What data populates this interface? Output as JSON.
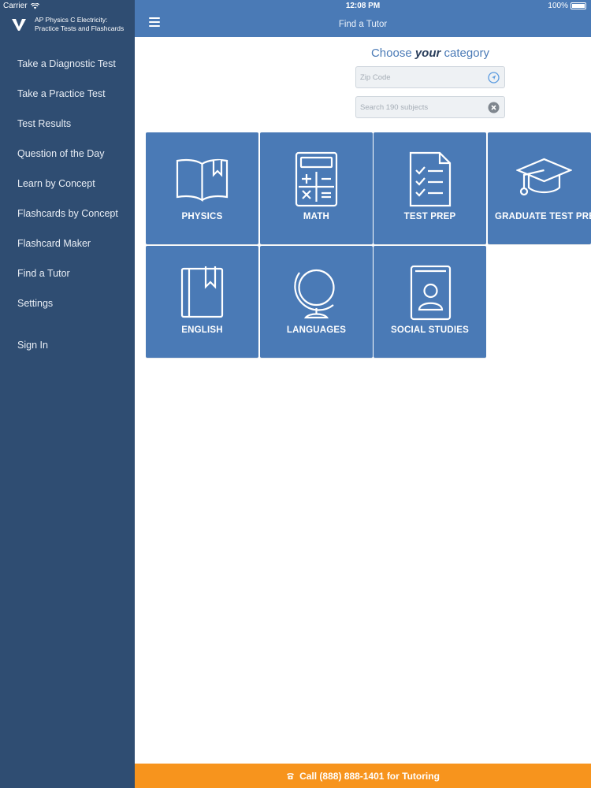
{
  "status": {
    "carrier": "Carrier",
    "time": "12:08 PM",
    "battery": "100%"
  },
  "brand": {
    "line1": "AP Physics C Electricity:",
    "line2": "Practice Tests and Flashcards"
  },
  "sidebar": {
    "items": [
      {
        "label": "Take a Diagnostic Test"
      },
      {
        "label": "Take a Practice Test"
      },
      {
        "label": "Test Results"
      },
      {
        "label": "Question of the Day"
      },
      {
        "label": "Learn by Concept"
      },
      {
        "label": "Flashcards by Concept"
      },
      {
        "label": "Flashcard Maker"
      },
      {
        "label": "Find a Tutor"
      },
      {
        "label": "Settings"
      },
      {
        "label": "Sign In"
      }
    ]
  },
  "header": {
    "title": "Find a Tutor"
  },
  "search": {
    "choose_pre": "Choose ",
    "choose_em": "your",
    "choose_post": " category",
    "zip_placeholder": "Zip Code",
    "subject_placeholder": "Search 190 subjects"
  },
  "categories": [
    {
      "label": "PHYSICS",
      "icon": "book-icon"
    },
    {
      "label": "MATH",
      "icon": "calculator-icon"
    },
    {
      "label": "TEST PREP",
      "icon": "checklist-icon"
    },
    {
      "label": "GRADUATE TEST PREP",
      "icon": "graduation-cap-icon"
    },
    {
      "label": "ENGLISH",
      "icon": "bookmarked-book-icon"
    },
    {
      "label": "LANGUAGES",
      "icon": "globe-icon"
    },
    {
      "label": "SOCIAL STUDIES",
      "icon": "person-book-icon"
    }
  ],
  "callbar": {
    "label": "Call (888) 888-1401 for Tutoring"
  },
  "colors": {
    "sidebar": "#2f4d72",
    "header": "#4a7ab6",
    "tile": "#4a7ab6",
    "call": "#f7941d"
  }
}
